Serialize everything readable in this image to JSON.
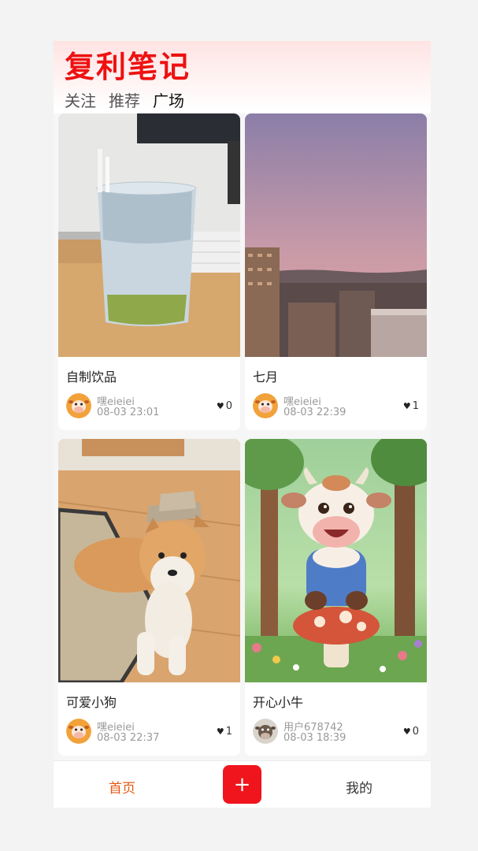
{
  "app": {
    "title": "复利笔记"
  },
  "tabs": [
    {
      "label": "关注",
      "active": false
    },
    {
      "label": "推荐",
      "active": false
    },
    {
      "label": "广场",
      "active": true
    }
  ],
  "posts": [
    {
      "title": "自制饮品",
      "author": "嘿eieiei",
      "date": "08-03 23:01",
      "likes": "0",
      "image": "bubble-tea-photo",
      "avatar": "cow-avatar"
    },
    {
      "title": "七月",
      "author": "嘿eieiei",
      "date": "08-03 22:39",
      "likes": "1",
      "image": "sunset-city-photo",
      "avatar": "cow-avatar"
    },
    {
      "title": "可爱小狗",
      "author": "嘿eieiei",
      "date": "08-03 22:37",
      "likes": "1",
      "image": "shiba-dog-photo",
      "avatar": "cow-avatar"
    },
    {
      "title": "开心小牛",
      "author": "用户678742",
      "date": "08-03 18:39",
      "likes": "0",
      "image": "cartoon-calf-illustration",
      "avatar": "cow-avatar-gray"
    }
  ],
  "nav": {
    "home": "首页",
    "add": "+",
    "mine": "我的"
  },
  "colors": {
    "brand_red": "#ee1111",
    "nav_active": "#e65b14",
    "add_button": "#f0151d"
  },
  "icons": {
    "like": "heart-icon"
  }
}
